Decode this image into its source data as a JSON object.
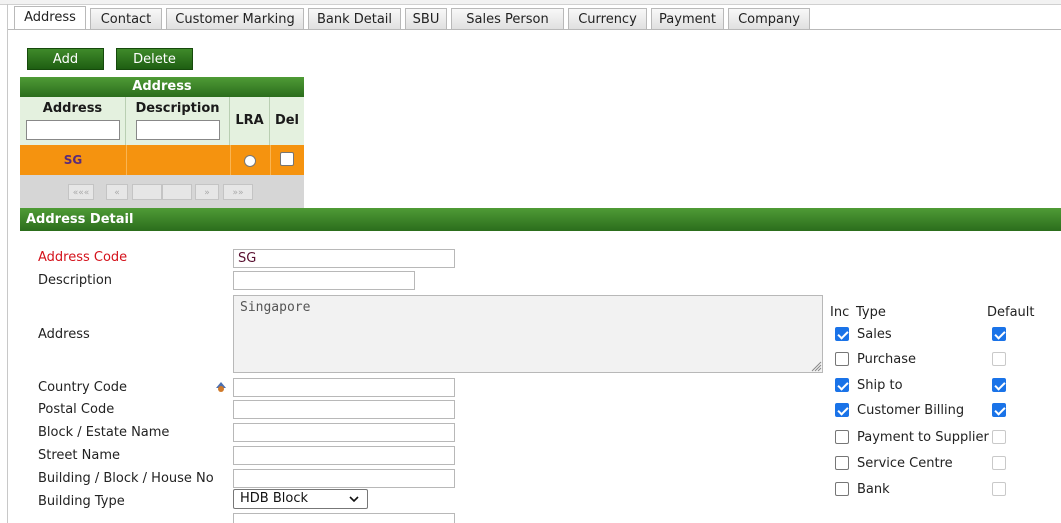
{
  "tabs": [
    "Address",
    "Contact",
    "Customer Marking",
    "Bank Detail",
    "SBU",
    "Sales Person",
    "Currency",
    "Payment",
    "Company"
  ],
  "toolbar": {
    "add": "Add",
    "delete": "Delete"
  },
  "grid": {
    "title": "Address",
    "columns": [
      "Address",
      "Description",
      "LRA",
      "Del"
    ],
    "row": {
      "address": "SG",
      "description": ""
    },
    "pager": {
      "first": "«««",
      "prev": "«",
      "next": "»",
      "last": "»»"
    }
  },
  "detail": {
    "title": "Address Detail",
    "labels": {
      "address_code": "Address Code",
      "description": "Description",
      "address": "Address",
      "country_code": "Country Code",
      "postal_code": "Postal Code",
      "block_estate": "Block / Estate Name",
      "street_name": "Street Name",
      "building_no": "Building / Block / House No",
      "building_type": "Building Type"
    },
    "values": {
      "address_code": "SG",
      "address": "Singapore",
      "building_type": "HDB Block"
    }
  },
  "types": {
    "headers": {
      "inc": "Inc",
      "type": "Type",
      "default": "Default"
    },
    "items": [
      {
        "label": "Sales",
        "inc": true,
        "default": true
      },
      {
        "label": "Purchase",
        "inc": false,
        "default": false
      },
      {
        "label": "Ship to",
        "inc": true,
        "default": true
      },
      {
        "label": "Customer Billing",
        "inc": true,
        "default": true
      },
      {
        "label": "Payment to Supplier",
        "inc": false,
        "default": false
      },
      {
        "label": "Service Centre",
        "inc": false,
        "default": false
      },
      {
        "label": "Bank",
        "inc": false,
        "default": false
      }
    ]
  },
  "colors": {
    "accent_green": "#2b6d1c",
    "row_orange": "#f5930f",
    "required_red": "#d4121b",
    "checkbox_blue": "#1a73e8"
  }
}
